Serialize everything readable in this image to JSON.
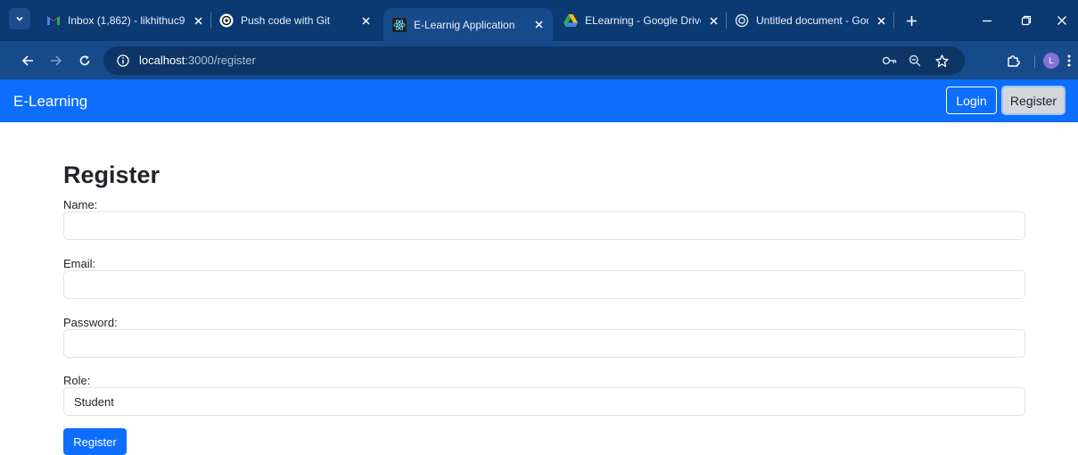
{
  "browser": {
    "tabs": [
      {
        "title": "Inbox (1,862) - likhithuc9",
        "icon": "gmail-icon",
        "active": false
      },
      {
        "title": "Push code with Git",
        "icon": "chatgpt-icon",
        "active": false
      },
      {
        "title": "E-Learnig Application",
        "icon": "react-icon",
        "active": true
      },
      {
        "title": "ELearning - Google Drive",
        "icon": "drive-icon",
        "active": false
      },
      {
        "title": "Untitled document - Goo",
        "icon": "docs-icon",
        "active": false
      }
    ],
    "url_host": "localhost",
    "url_rest": ":3000/register",
    "profile_initial": "L"
  },
  "navbar": {
    "brand": "E-Learning",
    "login_label": "Login",
    "register_label": "Register"
  },
  "form": {
    "title": "Register",
    "name_label": "Name:",
    "name_value": "",
    "email_label": "Email:",
    "email_value": "",
    "password_label": "Password:",
    "password_value": "",
    "role_label": "Role:",
    "role_value": "Student",
    "submit_label": "Register"
  },
  "colors": {
    "primary": "#0d6efd",
    "chrome_frame": "#0b3a73",
    "chrome_toolbar": "#174a8a"
  }
}
